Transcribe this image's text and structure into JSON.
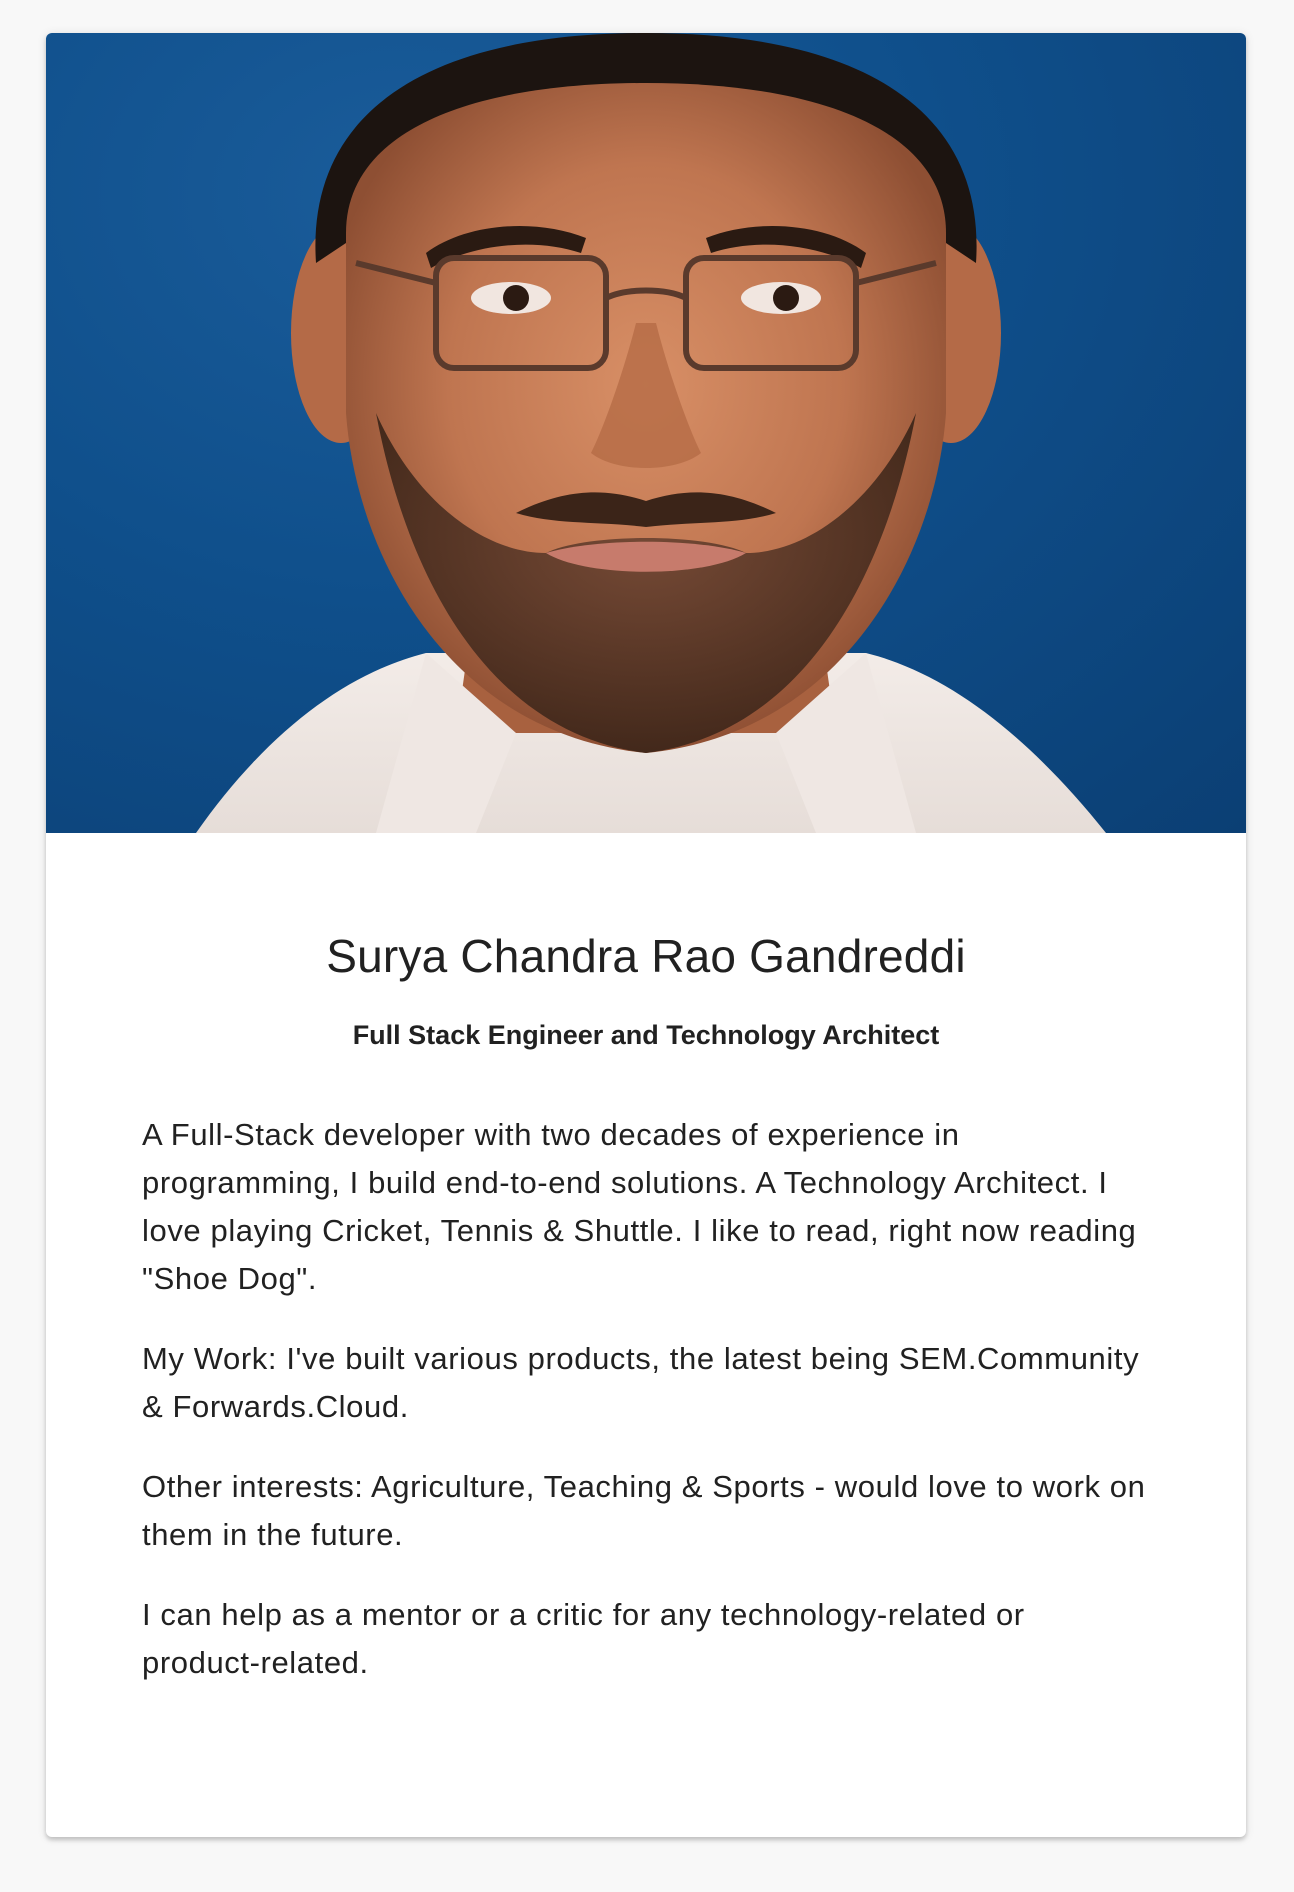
{
  "profile": {
    "photo_alt": "Surya Chandra Rao Gandreddi",
    "name": "Surya Chandra Rao Gandreddi",
    "title": "Full Stack Engineer and Technology Architect",
    "bio": [
      "A Full-Stack developer with two decades of experience in programming, I build end-to-end solutions. A Technology Architect. I love playing Cricket, Tennis & Shuttle. I like to read, right now reading \"Shoe Dog\".",
      "My Work: I've built various products, the latest being SEM.Community & Forwards.Cloud.",
      "Other interests: Agriculture, Teaching & Sports - would love to work on them in the future.",
      "I can help as a mentor or a critic for any technology-related or product-related."
    ]
  },
  "colors": {
    "page_background": "#f8f8f8",
    "card_background": "#ffffff",
    "photo_background": "#0f4f8b",
    "text": "#212121"
  }
}
